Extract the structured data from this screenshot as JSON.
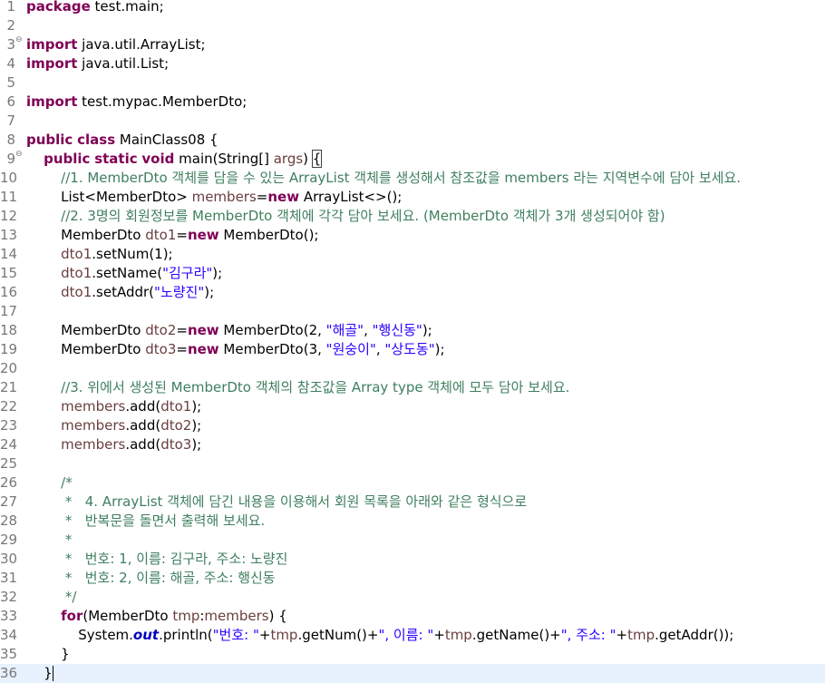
{
  "editor": {
    "line_numbers": [
      "1",
      "2",
      "3",
      "4",
      "5",
      "6",
      "7",
      "8",
      "9",
      "10",
      "11",
      "12",
      "13",
      "14",
      "15",
      "16",
      "17",
      "18",
      "19",
      "20",
      "21",
      "22",
      "23",
      "24",
      "25",
      "26",
      "27",
      "28",
      "29",
      "30",
      "31",
      "32",
      "33",
      "34",
      "35",
      "36"
    ],
    "lines": [
      {
        "i": "",
        "t": [
          {
            "c": "kw",
            "v": "package"
          },
          {
            "c": "",
            "v": " test.main;"
          }
        ]
      },
      {
        "i": "",
        "t": []
      },
      {
        "i": "",
        "fold": true,
        "t": [
          {
            "c": "kw",
            "v": "import"
          },
          {
            "c": "",
            "v": " java.util.ArrayList;"
          }
        ]
      },
      {
        "i": "",
        "t": [
          {
            "c": "kw",
            "v": "import"
          },
          {
            "c": "",
            "v": " java.util.List;"
          }
        ]
      },
      {
        "i": "",
        "t": []
      },
      {
        "i": "",
        "t": [
          {
            "c": "kw",
            "v": "import"
          },
          {
            "c": "",
            "v": " test.mypac.MemberDto;"
          }
        ]
      },
      {
        "i": "",
        "t": []
      },
      {
        "i": "",
        "t": [
          {
            "c": "kw",
            "v": "public"
          },
          {
            "c": "",
            "v": " "
          },
          {
            "c": "kw",
            "v": "class"
          },
          {
            "c": "",
            "v": " MainClass08 {"
          }
        ]
      },
      {
        "i": "    ",
        "fold": true,
        "t": [
          {
            "c": "kw",
            "v": "public"
          },
          {
            "c": "",
            "v": " "
          },
          {
            "c": "kw",
            "v": "static"
          },
          {
            "c": "",
            "v": " "
          },
          {
            "c": "kw",
            "v": "void"
          },
          {
            "c": "",
            "v": " main(String[] "
          },
          {
            "c": "var",
            "v": "args"
          },
          {
            "c": "",
            "v": ") "
          },
          {
            "c": "box",
            "v": "{"
          }
        ]
      },
      {
        "i": "        ",
        "t": [
          {
            "c": "cm",
            "v": "//1. MemberDto 객체를 담을 수 있는 ArrayList 객체를 생성해서 참조값을 members 라는 지역변수에 담아 보세요."
          }
        ]
      },
      {
        "i": "        ",
        "t": [
          {
            "c": "",
            "v": "List<MemberDto> "
          },
          {
            "c": "var",
            "v": "members"
          },
          {
            "c": "",
            "v": "="
          },
          {
            "c": "kw",
            "v": "new"
          },
          {
            "c": "",
            "v": " ArrayList<>();"
          }
        ]
      },
      {
        "i": "        ",
        "t": [
          {
            "c": "cm",
            "v": "//2. 3명의 회원정보를 MemberDto 객체에 각각 담아 보세요. (MemberDto 객체가 3개 생성되어야 함)"
          }
        ]
      },
      {
        "i": "        ",
        "t": [
          {
            "c": "",
            "v": "MemberDto "
          },
          {
            "c": "var",
            "v": "dto1"
          },
          {
            "c": "",
            "v": "="
          },
          {
            "c": "kw",
            "v": "new"
          },
          {
            "c": "",
            "v": " MemberDto();"
          }
        ]
      },
      {
        "i": "        ",
        "t": [
          {
            "c": "var",
            "v": "dto1"
          },
          {
            "c": "",
            "v": ".setNum(1);"
          }
        ]
      },
      {
        "i": "        ",
        "t": [
          {
            "c": "var",
            "v": "dto1"
          },
          {
            "c": "",
            "v": ".setName("
          },
          {
            "c": "st",
            "v": "\"김구라\""
          },
          {
            "c": "",
            "v": ");"
          }
        ]
      },
      {
        "i": "        ",
        "t": [
          {
            "c": "var",
            "v": "dto1"
          },
          {
            "c": "",
            "v": ".setAddr("
          },
          {
            "c": "st",
            "v": "\"노량진\""
          },
          {
            "c": "",
            "v": ");"
          }
        ]
      },
      {
        "i": "",
        "t": []
      },
      {
        "i": "        ",
        "t": [
          {
            "c": "",
            "v": "MemberDto "
          },
          {
            "c": "var",
            "v": "dto2"
          },
          {
            "c": "",
            "v": "="
          },
          {
            "c": "kw",
            "v": "new"
          },
          {
            "c": "",
            "v": " MemberDto(2, "
          },
          {
            "c": "st",
            "v": "\"해골\""
          },
          {
            "c": "",
            "v": ", "
          },
          {
            "c": "st",
            "v": "\"행신동\""
          },
          {
            "c": "",
            "v": ");"
          }
        ]
      },
      {
        "i": "        ",
        "t": [
          {
            "c": "",
            "v": "MemberDto "
          },
          {
            "c": "var",
            "v": "dto3"
          },
          {
            "c": "",
            "v": "="
          },
          {
            "c": "kw",
            "v": "new"
          },
          {
            "c": "",
            "v": " MemberDto(3, "
          },
          {
            "c": "st",
            "v": "\"원숭이\""
          },
          {
            "c": "",
            "v": ", "
          },
          {
            "c": "st",
            "v": "\"상도동\""
          },
          {
            "c": "",
            "v": ");"
          }
        ]
      },
      {
        "i": "",
        "t": []
      },
      {
        "i": "        ",
        "t": [
          {
            "c": "cm",
            "v": "//3. 위에서 생성된 MemberDto 객체의 참조값을 Array type 객체에 모두 담아 보세요."
          }
        ]
      },
      {
        "i": "        ",
        "t": [
          {
            "c": "var",
            "v": "members"
          },
          {
            "c": "",
            "v": ".add("
          },
          {
            "c": "var",
            "v": "dto1"
          },
          {
            "c": "",
            "v": ");"
          }
        ]
      },
      {
        "i": "        ",
        "t": [
          {
            "c": "var",
            "v": "members"
          },
          {
            "c": "",
            "v": ".add("
          },
          {
            "c": "var",
            "v": "dto2"
          },
          {
            "c": "",
            "v": ");"
          }
        ]
      },
      {
        "i": "        ",
        "t": [
          {
            "c": "var",
            "v": "members"
          },
          {
            "c": "",
            "v": ".add("
          },
          {
            "c": "var",
            "v": "dto3"
          },
          {
            "c": "",
            "v": ");"
          }
        ]
      },
      {
        "i": "",
        "t": []
      },
      {
        "i": "        ",
        "t": [
          {
            "c": "cm",
            "v": "/*"
          }
        ]
      },
      {
        "i": "        ",
        "t": [
          {
            "c": "cm",
            "v": " *   4. ArrayList 객체에 담긴 내용을 이용해서 회원 목록을 아래와 같은 형식으로"
          }
        ]
      },
      {
        "i": "        ",
        "t": [
          {
            "c": "cm",
            "v": " *   반복문을 돌면서 출력해 보세요."
          }
        ]
      },
      {
        "i": "        ",
        "t": [
          {
            "c": "cm",
            "v": " *"
          }
        ]
      },
      {
        "i": "        ",
        "t": [
          {
            "c": "cm",
            "v": " *   번호: 1, 이름: 김구라, 주소: 노량진"
          }
        ]
      },
      {
        "i": "        ",
        "t": [
          {
            "c": "cm",
            "v": " *   번호: 2, 이름: 해골, 주소: 행신동"
          }
        ]
      },
      {
        "i": "        ",
        "t": [
          {
            "c": "cm",
            "v": " */"
          }
        ]
      },
      {
        "i": "        ",
        "t": [
          {
            "c": "kw",
            "v": "for"
          },
          {
            "c": "",
            "v": "(MemberDto "
          },
          {
            "c": "var",
            "v": "tmp"
          },
          {
            "c": "",
            "v": ":"
          },
          {
            "c": "var",
            "v": "members"
          },
          {
            "c": "",
            "v": ") {"
          }
        ]
      },
      {
        "i": "            ",
        "t": [
          {
            "c": "",
            "v": "System."
          },
          {
            "c": "stf",
            "v": "out"
          },
          {
            "c": "",
            "v": ".println("
          },
          {
            "c": "st",
            "v": "\"번호: \""
          },
          {
            "c": "",
            "v": "+"
          },
          {
            "c": "var",
            "v": "tmp"
          },
          {
            "c": "",
            "v": ".getNum()+"
          },
          {
            "c": "st",
            "v": "\", 이름: \""
          },
          {
            "c": "",
            "v": "+"
          },
          {
            "c": "var",
            "v": "tmp"
          },
          {
            "c": "",
            "v": ".getName()+"
          },
          {
            "c": "st",
            "v": "\", 주소: \""
          },
          {
            "c": "",
            "v": "+"
          },
          {
            "c": "var",
            "v": "tmp"
          },
          {
            "c": "",
            "v": ".getAddr());"
          }
        ]
      },
      {
        "i": "        ",
        "t": [
          {
            "c": "",
            "v": "}"
          }
        ]
      },
      {
        "i": "    ",
        "current": true,
        "t": [
          {
            "c": "caret",
            "v": "}"
          }
        ]
      }
    ],
    "colors": {
      "keyword": "#7f0055",
      "comment": "#3f7f5f",
      "string": "#2a00ff",
      "local_variable": "#6a3e3e",
      "static_field": "#0000c0",
      "line_number": "#787878",
      "current_line": "#e8f2fe"
    }
  }
}
